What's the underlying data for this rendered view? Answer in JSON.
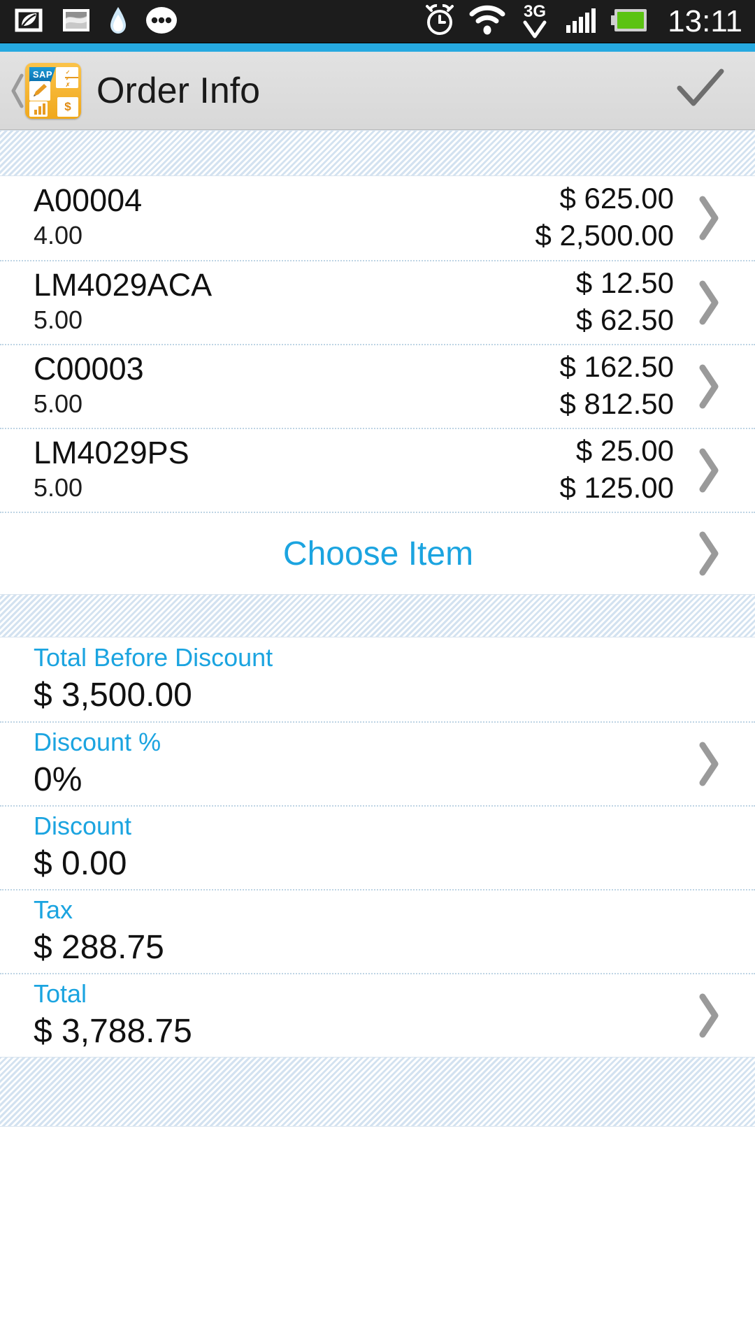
{
  "status_bar": {
    "time": "13:11",
    "left_icons": [
      "eco-leaf-icon",
      "gallery-image-icon",
      "water-drop-icon",
      "more-dots-icon"
    ],
    "right_icons": [
      "alarm-clock-icon",
      "wifi-icon",
      "3g-network-icon",
      "signal-bars-icon",
      "battery-icon"
    ],
    "network_label": "3G"
  },
  "header": {
    "back_label": "Back",
    "app_icon_label": "SAP",
    "title": "Order Info",
    "confirm_label": "Confirm"
  },
  "colors": {
    "accent_blue": "#26a9e0",
    "link_blue": "#1ba4e0",
    "stripe_blue": "#d3e2f0",
    "app_icon_orange": "#f0a81c"
  },
  "items": [
    {
      "code": "A00004",
      "quantity": "4.00",
      "unit_price": "$ 625.00",
      "line_total": "$ 2,500.00"
    },
    {
      "code": "LM4029ACA",
      "quantity": "5.00",
      "unit_price": "$ 12.50",
      "line_total": "$ 62.50"
    },
    {
      "code": "C00003",
      "quantity": "5.00",
      "unit_price": "$ 162.50",
      "line_total": "$ 812.50"
    },
    {
      "code": "LM4029PS",
      "quantity": "5.00",
      "unit_price": "$ 25.00",
      "line_total": "$ 125.00"
    }
  ],
  "choose_item": {
    "label": "Choose Item"
  },
  "totals": [
    {
      "label": "Total Before Discount",
      "value": "$ 3,500.00",
      "has_chevron": false
    },
    {
      "label": "Discount %",
      "value": "0%",
      "has_chevron": true
    },
    {
      "label": "Discount",
      "value": "$ 0.00",
      "has_chevron": false
    },
    {
      "label": "Tax",
      "value": "$ 288.75",
      "has_chevron": false
    },
    {
      "label": "Total",
      "value": "$ 3,788.75",
      "has_chevron": true
    }
  ]
}
